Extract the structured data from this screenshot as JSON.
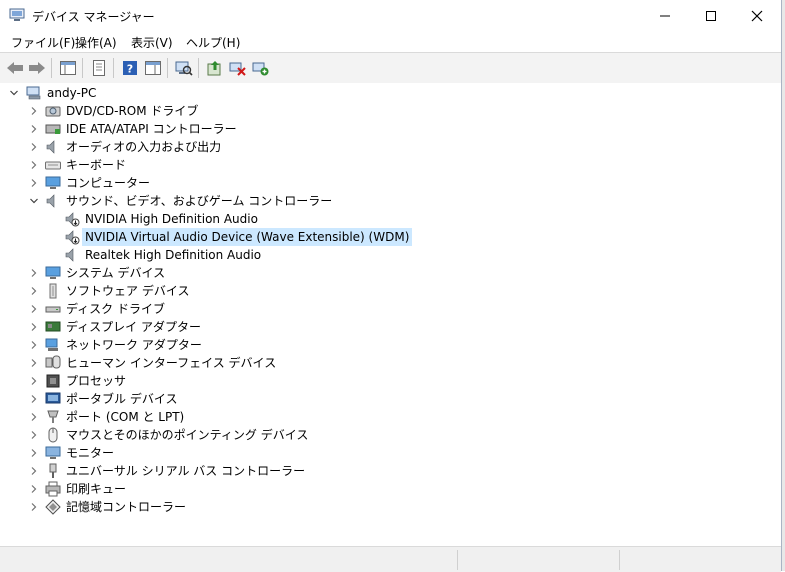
{
  "window": {
    "title": "デバイス マネージャー"
  },
  "menu": [
    "ファイル(F)",
    "操作(A)",
    "表示(V)",
    "ヘルプ(H)"
  ],
  "tree": {
    "root": "andy-PC",
    "categories": [
      {
        "label": "DVD/CD-ROM ドライブ",
        "icon": "dvd-drive-icon",
        "expanded": false
      },
      {
        "label": "IDE ATA/ATAPI コントローラー",
        "icon": "ide-controller-icon",
        "expanded": false
      },
      {
        "label": "オーディオの入力および出力",
        "icon": "audio-io-icon",
        "expanded": false
      },
      {
        "label": "キーボード",
        "icon": "keyboard-icon",
        "expanded": false
      },
      {
        "label": "コンピューター",
        "icon": "computer-icon",
        "expanded": false
      },
      {
        "label": "サウンド、ビデオ、およびゲーム コントローラー",
        "icon": "sound-icon",
        "expanded": true,
        "children": [
          {
            "label": "NVIDIA High Definition Audio",
            "icon": "speaker-disabled-icon",
            "selected": false
          },
          {
            "label": "NVIDIA Virtual Audio Device (Wave Extensible) (WDM)",
            "icon": "speaker-disabled-icon",
            "selected": true
          },
          {
            "label": "Realtek High Definition Audio",
            "icon": "speaker-icon",
            "selected": false
          }
        ]
      },
      {
        "label": "システム デバイス",
        "icon": "system-devices-icon",
        "expanded": false
      },
      {
        "label": "ソフトウェア デバイス",
        "icon": "software-devices-icon",
        "expanded": false
      },
      {
        "label": "ディスク ドライブ",
        "icon": "disk-drive-icon",
        "expanded": false
      },
      {
        "label": "ディスプレイ アダプター",
        "icon": "display-adapter-icon",
        "expanded": false
      },
      {
        "label": "ネットワーク アダプター",
        "icon": "network-adapter-icon",
        "expanded": false
      },
      {
        "label": "ヒューマン インターフェイス デバイス",
        "icon": "hid-icon",
        "expanded": false
      },
      {
        "label": "プロセッサ",
        "icon": "processor-icon",
        "expanded": false
      },
      {
        "label": "ポータブル デバイス",
        "icon": "portable-device-icon",
        "expanded": false
      },
      {
        "label": "ポート (COM と LPT)",
        "icon": "port-icon",
        "expanded": false
      },
      {
        "label": "マウスとそのほかのポインティング デバイス",
        "icon": "mouse-icon",
        "expanded": false
      },
      {
        "label": "モニター",
        "icon": "monitor-icon",
        "expanded": false
      },
      {
        "label": "ユニバーサル シリアル バス コントローラー",
        "icon": "usb-icon",
        "expanded": false
      },
      {
        "label": "印刷キュー",
        "icon": "printer-icon",
        "expanded": false
      },
      {
        "label": "記憶域コントローラー",
        "icon": "storage-controller-icon",
        "expanded": false
      }
    ]
  },
  "colors": {
    "selection": "#cce8ff",
    "toolbar_bg": "#f3f3f3",
    "status_bg": "#f0f0f0"
  }
}
